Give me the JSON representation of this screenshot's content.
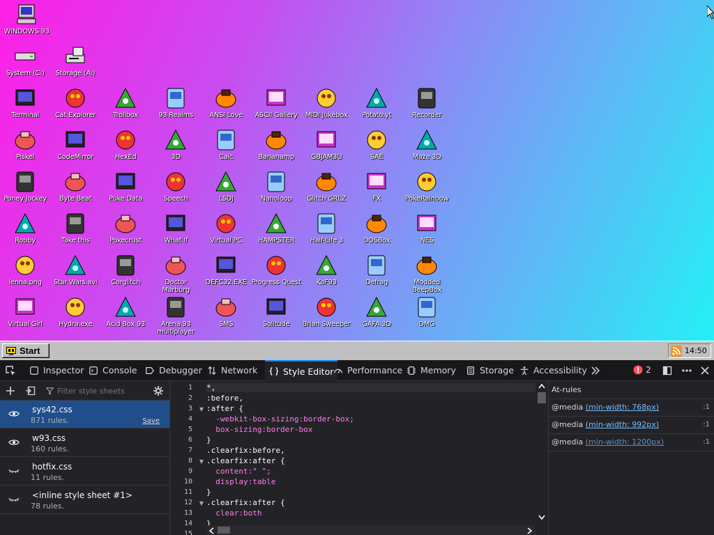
{
  "desktop": {
    "system_icons": [
      {
        "label": "WINDOWS 93",
        "icon": "windows93-computer-icon"
      },
      {
        "label": "System (C:)",
        "icon": "drive-c-icon"
      },
      {
        "label": "Storage (A:)",
        "icon": "floppy-drive-icon"
      }
    ],
    "rows": [
      [
        "Terminal",
        "Cat Explorer",
        "Trollbox",
        "93 Realms",
        "ANSI Love",
        "ASCII Gallery",
        "MIDI Jukebox",
        "Potato.yt",
        "Recorder"
      ],
      [
        "Piskel",
        "CodeMirror",
        "HexEd",
        "3D",
        "Calc",
        "Bananamp",
        "GBJAM3U",
        "SAE",
        "Maze 3D"
      ],
      [
        "Poney Jockey",
        "Byte Beat",
        "Puke Data",
        "Speech",
        "LSDJ",
        "Nanoloop",
        "Glitch GRLZ",
        "FX",
        "PokeRainbow"
      ],
      [
        "Robby",
        "Take this",
        "Pokecrust",
        "What If",
        "Virtual PC",
        "HAMPSTER",
        "Half-Life 3",
        "DOSBox",
        "NES"
      ],
      [
        "lenna.png",
        "Star Wars.avi",
        "Corglitch",
        "Doctor Marburg",
        "DEFC32.EXE",
        "Progress Quest",
        "KoF93",
        "Defrag",
        "Modded BeepBox"
      ],
      [
        "Virtual Girl",
        "Hydra.exe",
        "Acid Box 93",
        "Arena 93 multiplayer",
        "SMS",
        "Solitude",
        "Brian Sweeper",
        "GAFA 3D",
        "DMG"
      ]
    ]
  },
  "taskbar": {
    "start_label": "Start",
    "clock": "14:50"
  },
  "devtools": {
    "tabs": [
      {
        "label": "Inspector",
        "icon": "inspector-icon"
      },
      {
        "label": "Console",
        "icon": "console-icon"
      },
      {
        "label": "Debugger",
        "icon": "debugger-icon"
      },
      {
        "label": "Network",
        "icon": "network-icon"
      },
      {
        "label": "Style Editor",
        "icon": "style-editor-icon",
        "selected": true
      },
      {
        "label": "Performance",
        "icon": "performance-icon"
      },
      {
        "label": "Memory",
        "icon": "memory-icon"
      },
      {
        "label": "Storage",
        "icon": "storage-icon"
      },
      {
        "label": "Accessibility",
        "icon": "accessibility-icon"
      }
    ],
    "error_count": "2",
    "filter_placeholder": "Filter style sheets",
    "sheets": [
      {
        "name": "sys42.css",
        "rules": "871 rules.",
        "visible": true,
        "save": "Save",
        "selected": true
      },
      {
        "name": "w93.css",
        "rules": "160 rules.",
        "visible": true
      },
      {
        "name": "hotfix.css",
        "rules": "11 rules.",
        "visible": false
      },
      {
        "name": "<inline style sheet #1>",
        "rules": "78 rules.",
        "visible": false
      }
    ],
    "code_lines": [
      "*,",
      ":before,",
      ":after {",
      "  -webkit-box-sizing:border-box;",
      "  box-sizing:border-box",
      "}",
      ".clearfix:before,",
      ".clearfix:after {",
      "  content:\" \";",
      "  display:table",
      "}",
      ".clearfix:after {",
      "  clear:both",
      "}"
    ],
    "line_numbers": [
      "1",
      "2",
      "3",
      "4",
      "5",
      "6",
      "7",
      "8",
      "9",
      "10",
      "11",
      "12",
      "13",
      "14",
      "15"
    ],
    "at_rules_title": "At-rules",
    "at_rules": [
      {
        "keyword": "@media",
        "condition": "(min-width: 768px)",
        "line": ":1"
      },
      {
        "keyword": "@media",
        "condition": "(min-width: 992px)",
        "line": ":1"
      },
      {
        "keyword": "@media",
        "condition": "(min-width: 1200px)",
        "line": ":1"
      }
    ]
  }
}
